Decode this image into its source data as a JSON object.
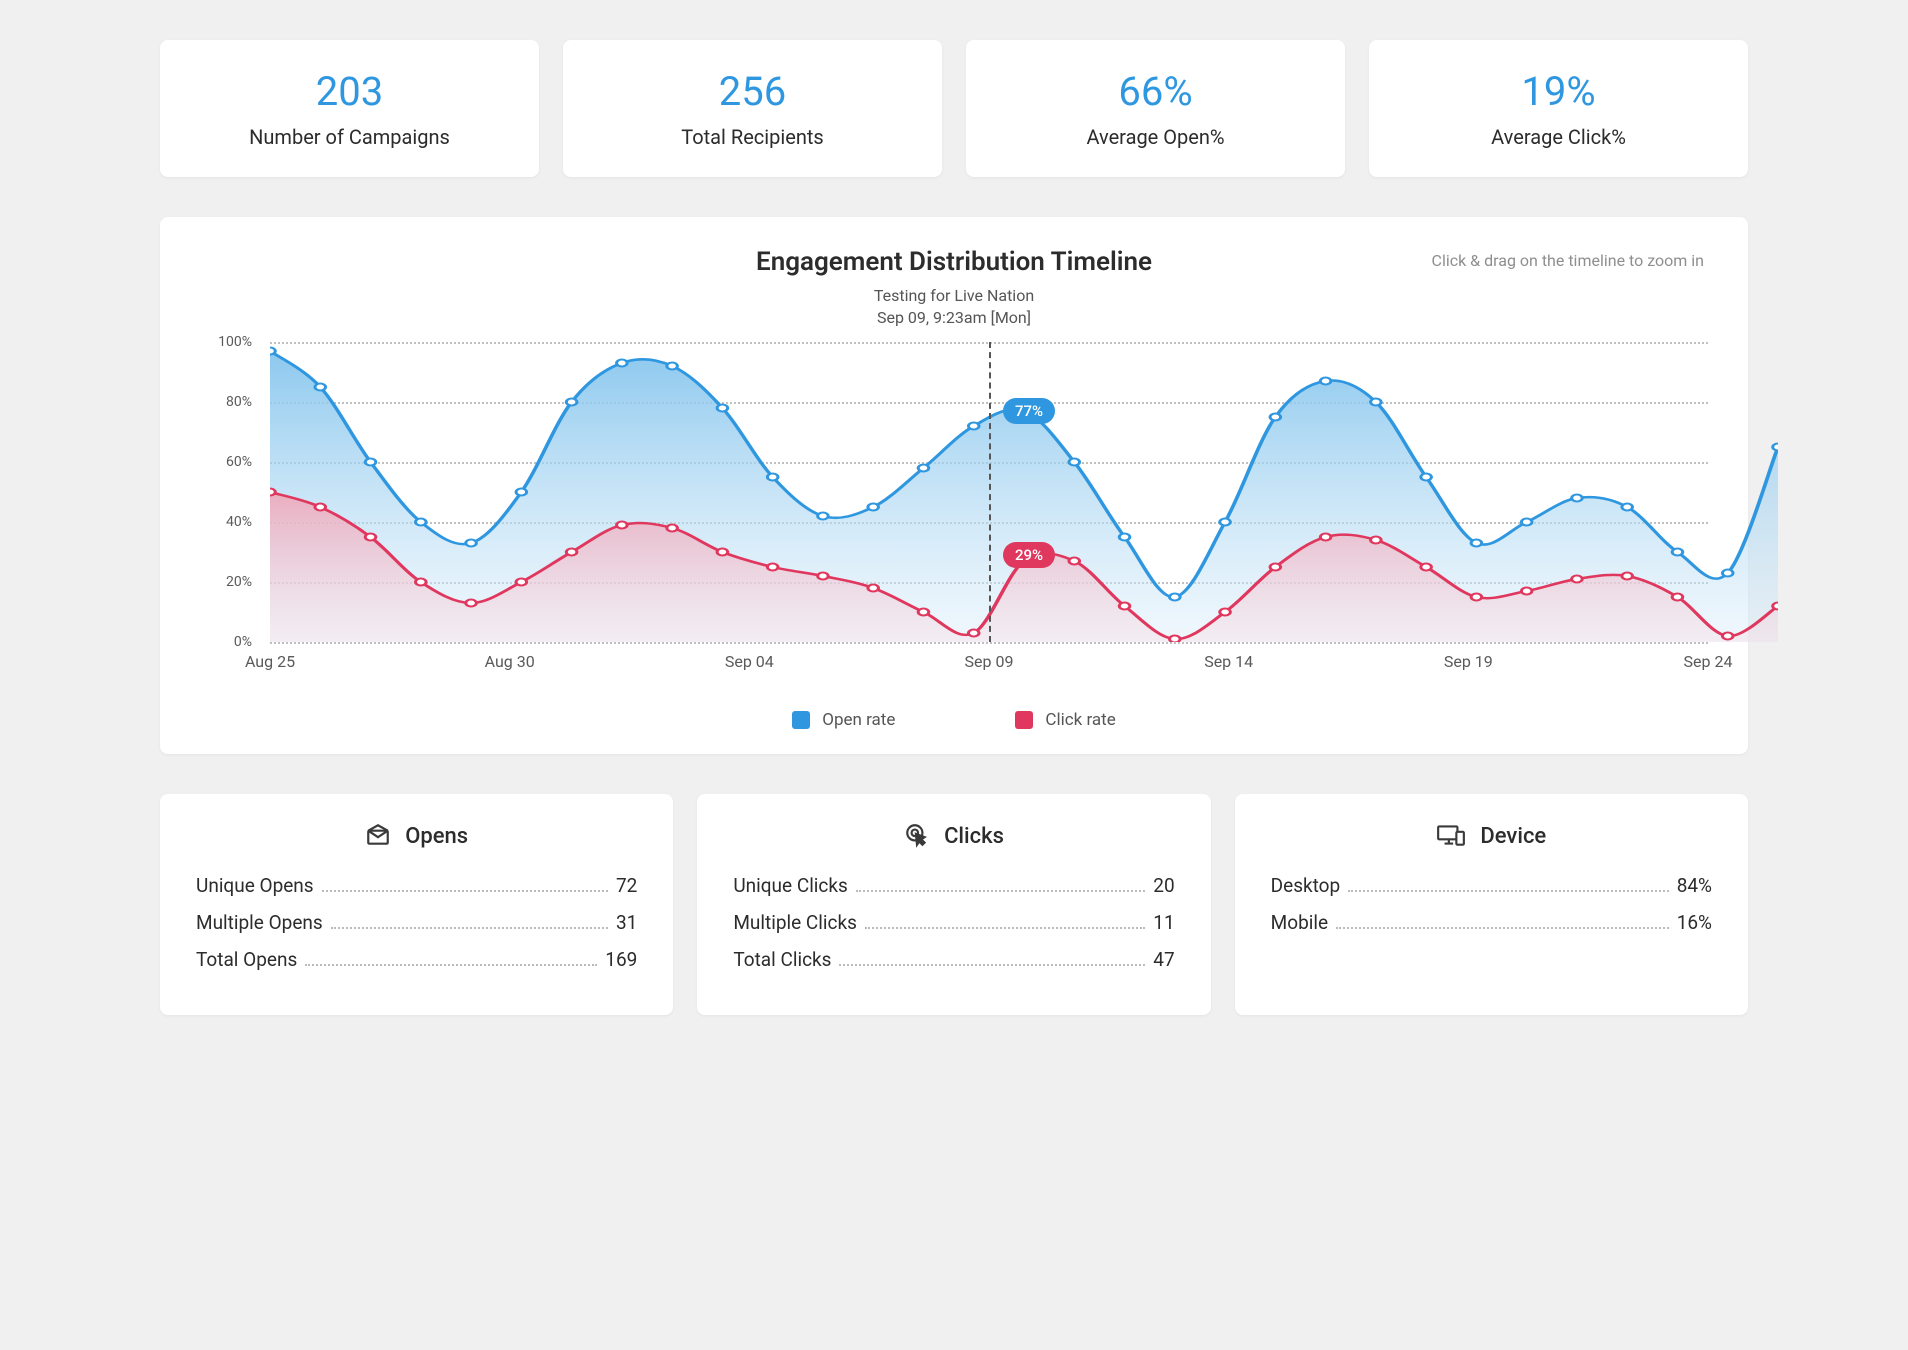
{
  "stats": [
    {
      "value": "203",
      "label": "Number of Campaigns"
    },
    {
      "value": "256",
      "label": "Total Recipients"
    },
    {
      "value": "66%",
      "label": "Average Open%"
    },
    {
      "value": "19%",
      "label": "Average Click%"
    }
  ],
  "chart": {
    "title": "Engagement Distribution Timeline",
    "hint": "Click & drag on the timeline to zoom in",
    "tooltip_line1": "Testing for Live Nation",
    "tooltip_line2": "Sep 09, 9:23am [Mon]",
    "highlight_badge_open": "77%",
    "highlight_badge_click": "29%",
    "legend_open": "Open rate",
    "legend_click": "Click rate",
    "y_ticks": [
      "0%",
      "20%",
      "40%",
      "60%",
      "80%",
      "100%"
    ],
    "x_ticks": [
      "Aug 25",
      "Aug 30",
      "Sep 04",
      "Sep 09",
      "Sep 14",
      "Sep 19",
      "Sep 24"
    ]
  },
  "chart_data": {
    "type": "area",
    "title": "Engagement Distribution Timeline",
    "xlabel": "",
    "ylabel": "",
    "ylim": [
      0,
      100
    ],
    "x": [
      0,
      1,
      2,
      3,
      4,
      5,
      6,
      7,
      8,
      9,
      10,
      11,
      12,
      13,
      14,
      15,
      16,
      17,
      18,
      19,
      20,
      21,
      22,
      23,
      24,
      25,
      26,
      27,
      28,
      29,
      30
    ],
    "x_tick_labels": {
      "0": "Aug 25",
      "5": "Aug 30",
      "10": "Sep 04",
      "15": "Sep 09",
      "20": "Sep 14",
      "25": "Sep 19",
      "30": "Sep 24"
    },
    "series": [
      {
        "name": "Open rate",
        "color": "#2f97e0",
        "values": [
          97,
          85,
          60,
          40,
          33,
          50,
          80,
          93,
          92,
          78,
          55,
          42,
          45,
          58,
          72,
          77,
          60,
          35,
          15,
          40,
          75,
          87,
          80,
          55,
          33,
          40,
          48,
          45,
          30,
          23,
          65
        ]
      },
      {
        "name": "Click rate",
        "color": "#e0375e",
        "values": [
          50,
          45,
          35,
          20,
          13,
          20,
          30,
          39,
          38,
          30,
          25,
          22,
          18,
          10,
          3,
          27,
          27,
          12,
          1,
          10,
          25,
          35,
          34,
          25,
          15,
          17,
          21,
          22,
          15,
          2,
          12
        ]
      }
    ],
    "highlight": {
      "x_index": 15,
      "open": 77,
      "click": 29,
      "label": "Testing for Live Nation — Sep 09, 9:23am [Mon]"
    }
  },
  "details": {
    "opens": {
      "title": "Opens",
      "rows": [
        {
          "label": "Unique Opens",
          "value": "72"
        },
        {
          "label": "Multiple Opens",
          "value": "31"
        },
        {
          "label": "Total Opens",
          "value": "169"
        }
      ]
    },
    "clicks": {
      "title": "Clicks",
      "rows": [
        {
          "label": "Unique Clicks",
          "value": "20"
        },
        {
          "label": "Multiple Clicks",
          "value": "11"
        },
        {
          "label": "Total Clicks",
          "value": "47"
        }
      ]
    },
    "device": {
      "title": "Device",
      "rows": [
        {
          "label": "Desktop",
          "value": "84%"
        },
        {
          "label": "Mobile",
          "value": "16%"
        }
      ]
    }
  }
}
